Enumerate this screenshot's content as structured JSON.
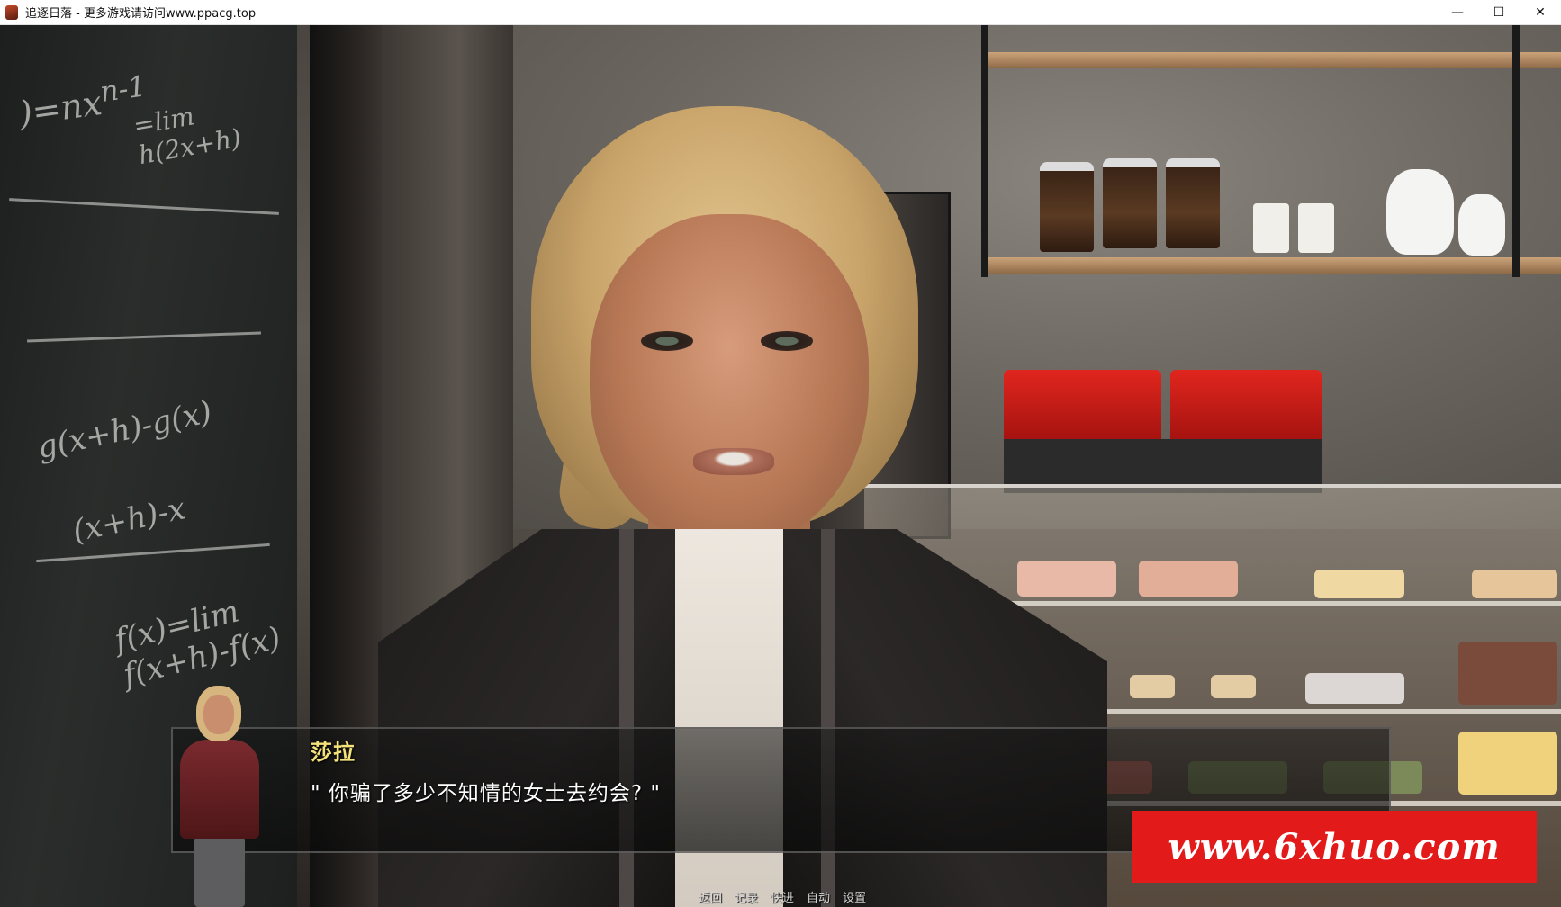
{
  "window": {
    "title": "追逐日落 - 更多游戏请访问www.ppacg.top",
    "controls": {
      "minimize": "—",
      "maximize": "☐",
      "close": "✕"
    }
  },
  "dialogue": {
    "speaker": "莎拉",
    "text": "\" 你骗了多少不知情的女士去约会? \""
  },
  "quick_menu": {
    "items": [
      "返回",
      "记录",
      "快进",
      "自动",
      "设置"
    ]
  },
  "watermark": {
    "text": "www.6xhuo.com"
  },
  "colors": {
    "speaker_name": "#f4e27a",
    "watermark_bg": "#e21a1a"
  }
}
